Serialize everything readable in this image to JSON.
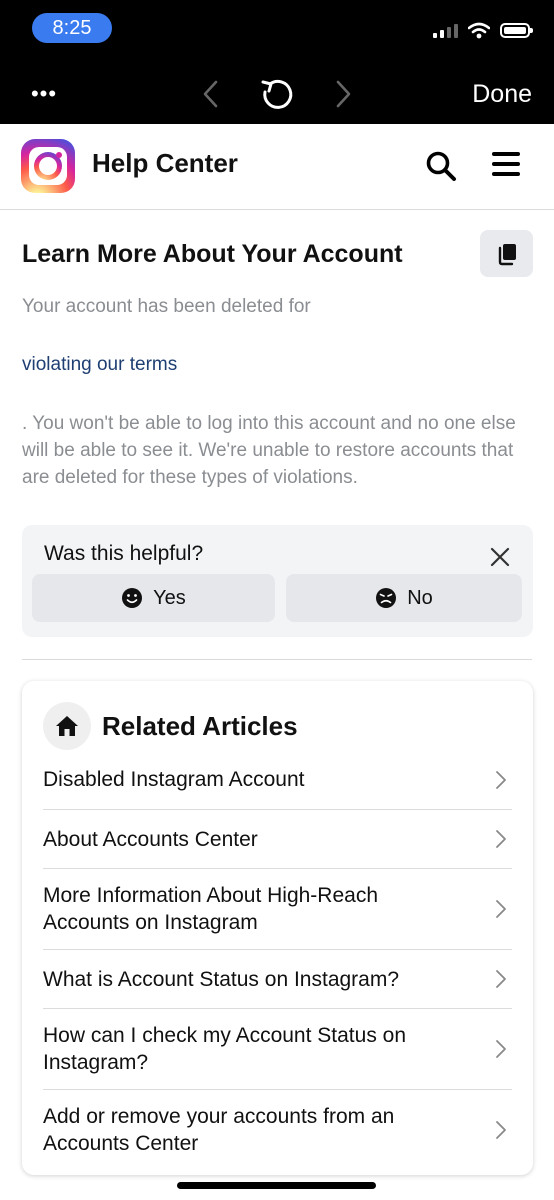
{
  "status_bar": {
    "time": "8:25"
  },
  "browser_toolbar": {
    "more_label": "•••",
    "done_label": "Done"
  },
  "help_center": {
    "title": "Help Center"
  },
  "article": {
    "title": "Learn More About Your Account",
    "intro": "Your account has been deleted for",
    "link_text": "violating our terms",
    "body": ". You won't be able to log into this account and no one else will be able to see it. We're unable to restore accounts that are deleted for these types of violations."
  },
  "helpful": {
    "question": "Was this helpful?",
    "yes_label": "Yes",
    "no_label": "No"
  },
  "related": {
    "title": "Related Articles",
    "items": [
      {
        "label": "Disabled Instagram Account"
      },
      {
        "label": "About Accounts Center"
      },
      {
        "label": "More Information About High-Reach Accounts on Instagram"
      },
      {
        "label": "What is Account Status on Instagram?"
      },
      {
        "label": "How can I check my Account Status on Instagram?"
      },
      {
        "label": "Add or remove your accounts from an Accounts Center"
      }
    ]
  },
  "colors": {
    "link": "#1f3f73",
    "time_pill": "#3a7bf0",
    "muted_text": "#8a8d91"
  }
}
